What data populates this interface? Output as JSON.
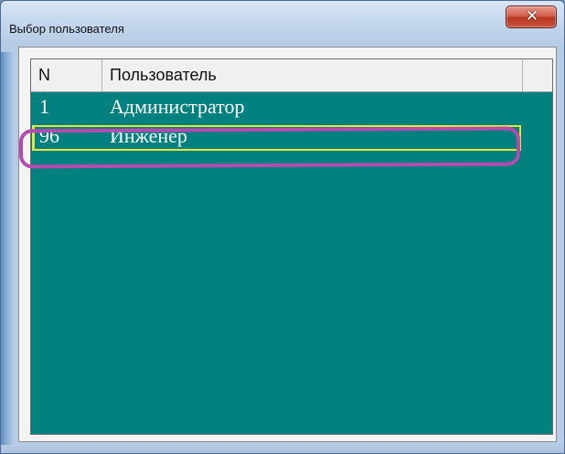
{
  "window": {
    "title": "Выбор пользователя"
  },
  "controls": {
    "close_icon": "close-icon",
    "close_glyph": "✕"
  },
  "table": {
    "columns": [
      "N",
      "Пользователь",
      ""
    ],
    "rows": [
      {
        "n": "1",
        "user": "Администратор"
      },
      {
        "n": "96",
        "user": "Инженер"
      }
    ],
    "selected_index": 1
  },
  "colors": {
    "grid_background": "#018080",
    "row_text": "#ffffff",
    "selection_frame": "#e5e53a",
    "annotation_ellipse": "#b54bb0",
    "close_button": "#c95641"
  }
}
